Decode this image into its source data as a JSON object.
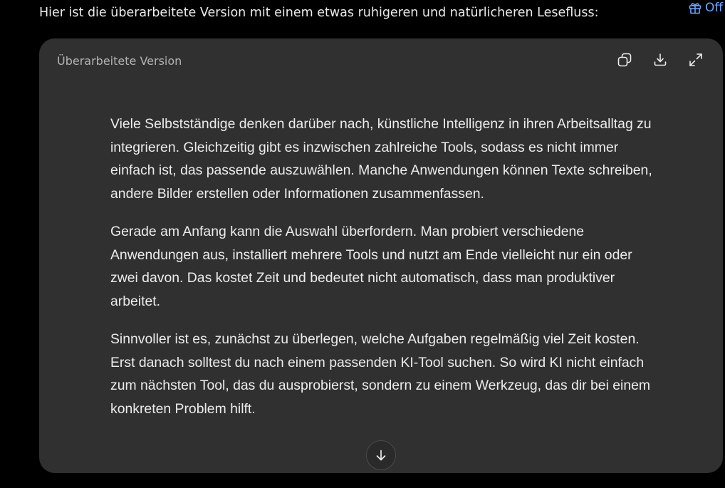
{
  "chat": {
    "intro_text": "Hier ist die überarbeitete Version mit einem etwas ruhigeren und natürlicheren Lesefluss:",
    "offer_label": "Off",
    "offer_icon": "gift-icon"
  },
  "canvas": {
    "title": "Überarbeitete Version",
    "actions": {
      "copy_icon": "copy-icon",
      "download_icon": "download-icon",
      "expand_icon": "expand-icon"
    },
    "paragraphs": [
      "Viele Selbstständige denken darüber nach, künstliche Intelligenz in ihren Arbeitsalltag zu integrieren. Gleichzeitig gibt es inzwischen zahlreiche Tools, sodass es nicht immer einfach ist, das passende auszuwählen. Manche Anwendungen können Texte schreiben, andere Bilder erstellen oder Informationen zusammenfassen.",
      "Gerade am Anfang kann die Auswahl überfordern. Man probiert verschiedene Anwendungen aus, installiert mehrere Tools und nutzt am Ende vielleicht nur ein oder zwei davon. Das kostet Zeit und bedeutet nicht automatisch, dass man produktiver arbeitet.",
      "Sinnvoller ist es, zunächst zu überlegen, welche Aufgaben regelmäßig viel Zeit kosten. Erst danach solltest du nach einem passenden KI-Tool suchen. So wird KI nicht einfach zum nächsten Tool, das du ausprobierst, sondern zu einem Werkzeug, das dir bei einem konkreten Problem hilft."
    ],
    "scroll_icon": "arrow-down-icon"
  },
  "colors": {
    "background": "#000000",
    "card": "#303030",
    "text": "#ececec",
    "muted": "#b4b4b4",
    "link": "#6aa8ff"
  }
}
